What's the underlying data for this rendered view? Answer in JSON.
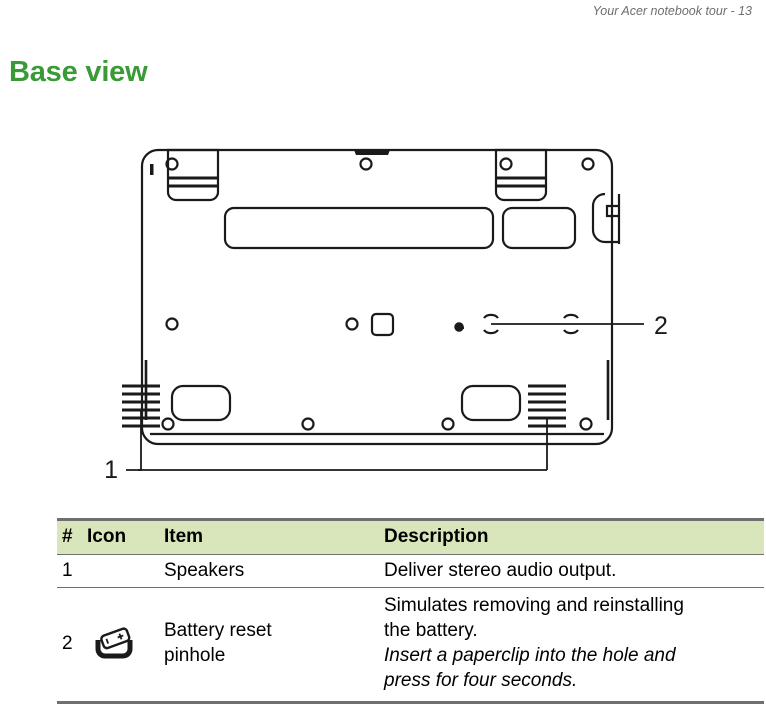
{
  "header": {
    "running_head": "Your Acer notebook tour - 13"
  },
  "section": {
    "title": "Base view",
    "title_color": "#3a9a35"
  },
  "figure": {
    "name": "notebook-base-view-diagram",
    "callouts": [
      {
        "number": "1",
        "target": "speakers"
      },
      {
        "number": "2",
        "target": "battery-reset-pinhole"
      }
    ]
  },
  "table": {
    "header_bg": "#d9e5ba",
    "border_color": "#6f6f6f",
    "columns": [
      "#",
      "Icon",
      "Item",
      "Description"
    ],
    "rows": [
      {
        "num": "1",
        "icon": "",
        "item": "Speakers",
        "desc_lines": [
          {
            "text": "Deliver stereo audio output.",
            "italic": false
          }
        ]
      },
      {
        "num": "2",
        "icon": "battery-reset-pinhole-icon",
        "item_line1": "Battery reset",
        "item_line2": "pinhole",
        "desc_lines": [
          {
            "text": "Simulates removing and reinstalling",
            "italic": false
          },
          {
            "text": "the battery.",
            "italic": false
          },
          {
            "text": "Insert a paperclip into the hole and",
            "italic": true
          },
          {
            "text": "press for four seconds.",
            "italic": true
          }
        ]
      }
    ]
  }
}
